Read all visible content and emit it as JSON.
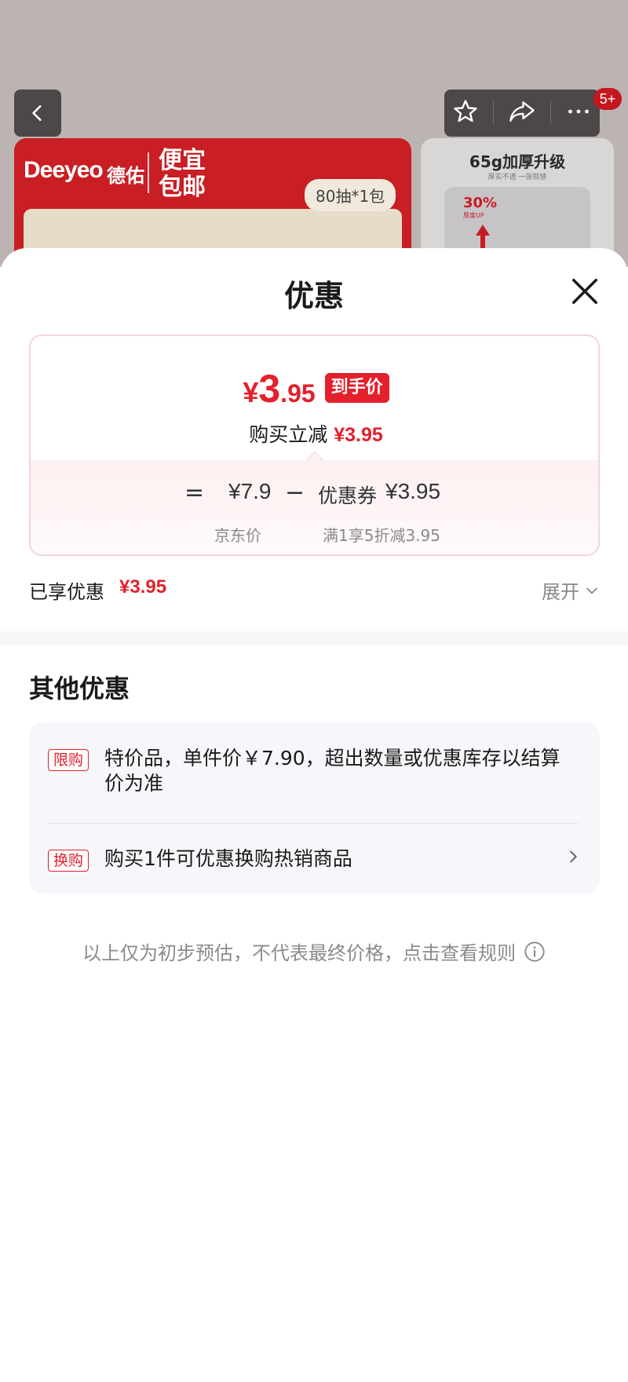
{
  "header": {
    "cart_badge": "5+"
  },
  "banner": {
    "brand": "Deeyeo",
    "brand_cn": "德佑",
    "slogan": "便宜包邮",
    "pack": "80抽*1包"
  },
  "side_card": {
    "title": "65g加厚升级",
    "subtitle": "厚实不透 一张就够",
    "percent": "30%",
    "percent_note": "厚度UP"
  },
  "sheet": {
    "title": "优惠",
    "final_price": {
      "yen": "¥",
      "integer": "3",
      "decimal": ".95"
    },
    "final_tag": "到手价",
    "instant_discount_label": "购买立减",
    "instant_discount_value": "¥3.95",
    "calc": {
      "equals": "=",
      "jd_price": "¥7.9",
      "jd_price_caption": "京东价",
      "minus": "−",
      "coupon_label": "优惠券",
      "coupon_value": "¥3.95",
      "coupon_caption": "满1享5折减3.95"
    },
    "enjoyed_label": "已享优惠",
    "enjoyed_value": "¥3.95",
    "expand_label": "展开"
  },
  "other": {
    "title": "其他优惠",
    "items": [
      {
        "tag": "限购",
        "text": "特价品，单件价￥7.90，超出数量或优惠库存以结算价为准"
      },
      {
        "tag": "换购",
        "text": "购买1件可优惠换购热销商品"
      }
    ]
  },
  "disclaimer": "以上仅为初步预估，不代表最终价格，点击查看规则",
  "colors": {
    "accent": "#e3202b",
    "muted": "#8a8a8a"
  }
}
